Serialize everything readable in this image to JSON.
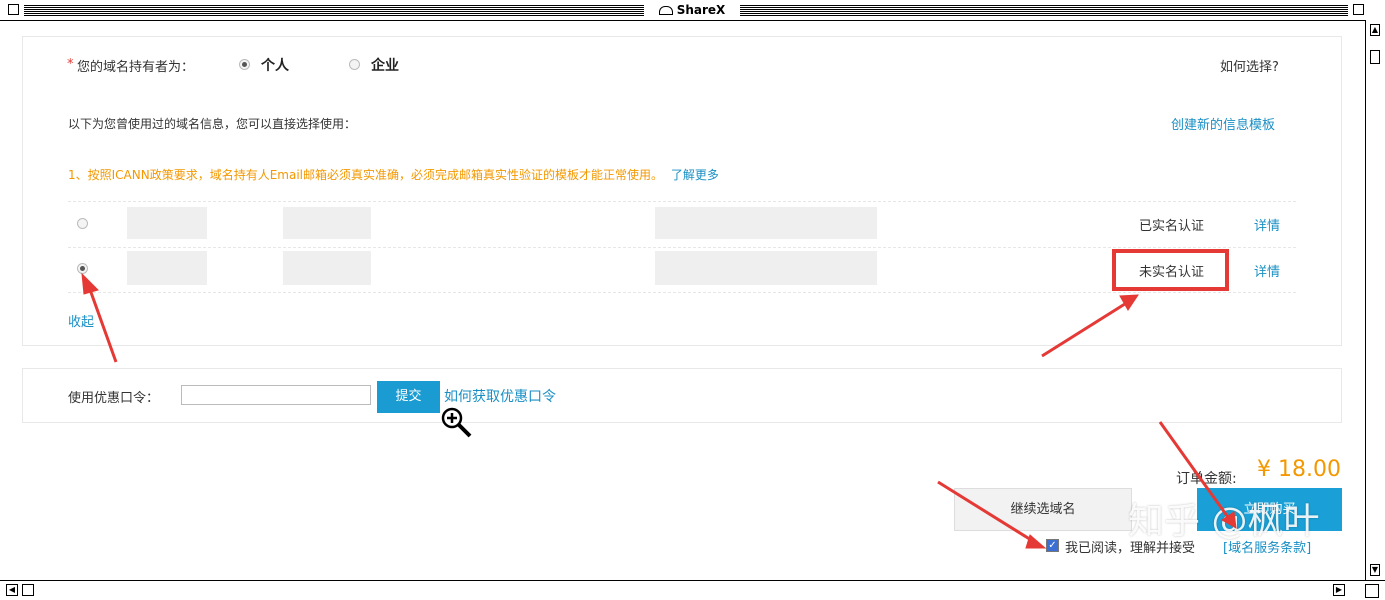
{
  "window": {
    "title": "ShareX"
  },
  "owner": {
    "required_mark": "*",
    "label": "您的域名持有者为：",
    "options": [
      {
        "label": "个人",
        "selected": true
      },
      {
        "label": "企业",
        "selected": false
      }
    ],
    "help_link": "如何选择?"
  },
  "templates": {
    "intro": "以下为您曾使用过的域名信息，您可以直接选择使用：",
    "create_link": "创建新的信息模板",
    "notice": "1、按照ICANN政策要求，域名持有人Email邮箱必须真实准确，必须完成邮箱真实性验证的模板才能正常使用。",
    "learn_more": "了解更多",
    "rows": [
      {
        "status": "已实名认证",
        "detail": "详情",
        "selected": false
      },
      {
        "status": "未实名认证",
        "detail": "详情",
        "selected": true
      }
    ],
    "collapse": "收起"
  },
  "coupon": {
    "label": "使用优惠口令：",
    "input_value": "",
    "submit": "提交",
    "help_link": "如何获取优惠口令"
  },
  "order": {
    "total_label": "订单金额:",
    "total_value": "¥ 18.00",
    "continue_button": "继续选域名",
    "buy_button": "立即购买",
    "agree_checked": true,
    "agree_text": "我已阅读，理解并接受",
    "terms_link": "[域名服务条款]"
  },
  "watermark": "知乎 @枫叶",
  "colors": {
    "accent_blue": "#1a9bd1",
    "link_blue": "#1a8fc4",
    "warning_orange": "#f39800",
    "annotation_red": "#e53935"
  }
}
